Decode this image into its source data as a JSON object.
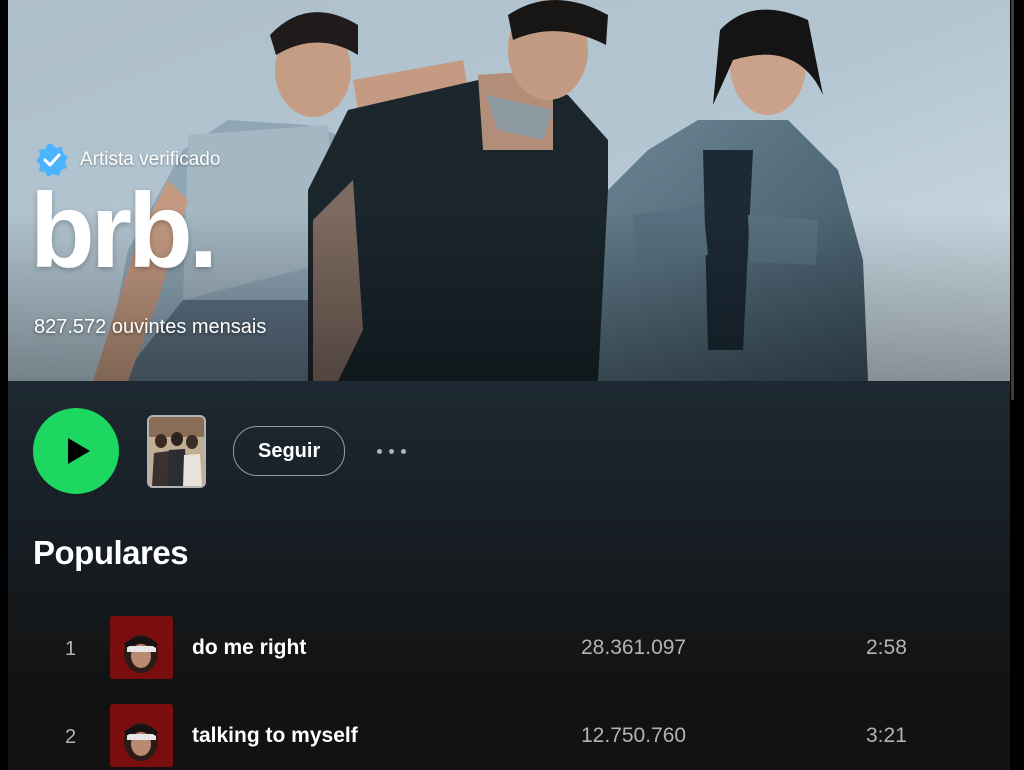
{
  "artist": {
    "verified_label": "Artista verificado",
    "name": "brb.",
    "monthly_listeners": "827.572 ouvintes mensais"
  },
  "actions": {
    "play_icon": "play-icon",
    "follow_label": "Seguir",
    "more_icon": "more-dots-icon"
  },
  "popular": {
    "title": "Populares",
    "tracks": [
      {
        "number": "1",
        "title": "do me right",
        "plays": "28.361.097",
        "duration": "2:58"
      },
      {
        "number": "2",
        "title": "talking to myself",
        "plays": "12.750.760",
        "duration": "3:21"
      }
    ]
  },
  "colors": {
    "accent": "#1ed760",
    "verified": "#4cb3ff",
    "cover": "#7a0d0d"
  }
}
